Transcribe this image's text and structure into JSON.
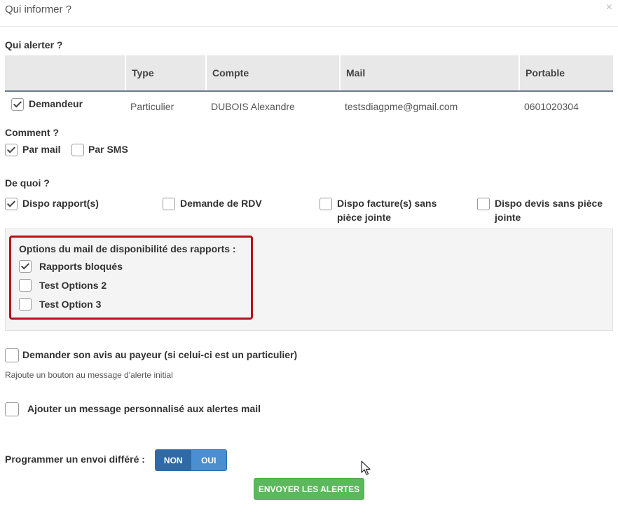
{
  "modal": {
    "title": "Qui informer ?",
    "close": "×"
  },
  "who": {
    "label": "Qui alerter ?",
    "columns": [
      "Type",
      "Compte",
      "Mail",
      "Portable"
    ],
    "row": {
      "checked": true,
      "role": "Demandeur",
      "type": "Particulier",
      "account": "DUBOIS Alexandre",
      "mail": "testsdiagpme@gmail.com",
      "mobile": "0601020304"
    }
  },
  "how": {
    "label": "Comment ?",
    "options": [
      {
        "label": "Par mail",
        "checked": true
      },
      {
        "label": "Par SMS",
        "checked": false
      }
    ]
  },
  "what": {
    "label": "De quoi ?",
    "options": [
      {
        "label": "Dispo rapport(s)",
        "checked": true
      },
      {
        "label": "Demande de RDV",
        "checked": false
      },
      {
        "label": "Dispo facture(s) sans",
        "label2": "pièce jointe",
        "checked": false
      },
      {
        "label": "Dispo devis sans pièce",
        "label2": "jointe",
        "checked": false
      }
    ]
  },
  "report_options": {
    "title": "Options du mail de disponibilité des rapports :",
    "options": [
      {
        "label": "Rapports bloqués",
        "checked": true
      },
      {
        "label": "Test Options 2",
        "checked": false
      },
      {
        "label": "Test Option 3",
        "checked": false
      }
    ],
    "highlight_color": "#b5121b"
  },
  "review": {
    "label": "Demander son avis au payeur (si celui-ci est un particulier)",
    "checked": false,
    "hint": "Rajoute un bouton au message d'alerte initial"
  },
  "custom_message": {
    "label": "Ajouter un message personnalisé aux alertes mail",
    "checked": false
  },
  "deferred": {
    "label": "Programmer un envoi différé :",
    "off_label": "NON",
    "on_label": "OUI",
    "selected": "NON"
  },
  "submit": {
    "label": "ENVOYER LES ALERTES",
    "color": "#5cb85c"
  }
}
